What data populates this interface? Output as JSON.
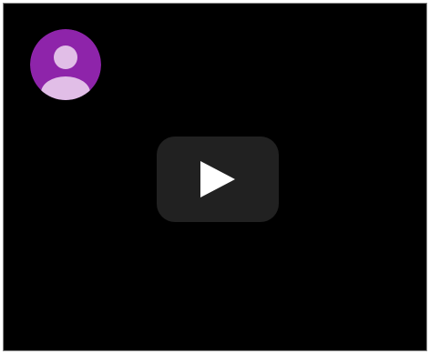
{
  "player": {
    "background_color": "#000000",
    "channel_avatar": {
      "icon": "user-avatar-icon",
      "background_color": "#8e24aa",
      "figure_color": "#e1bee7"
    },
    "play_button": {
      "icon": "play-icon",
      "background_color": "#212121",
      "icon_color": "#ffffff"
    }
  }
}
